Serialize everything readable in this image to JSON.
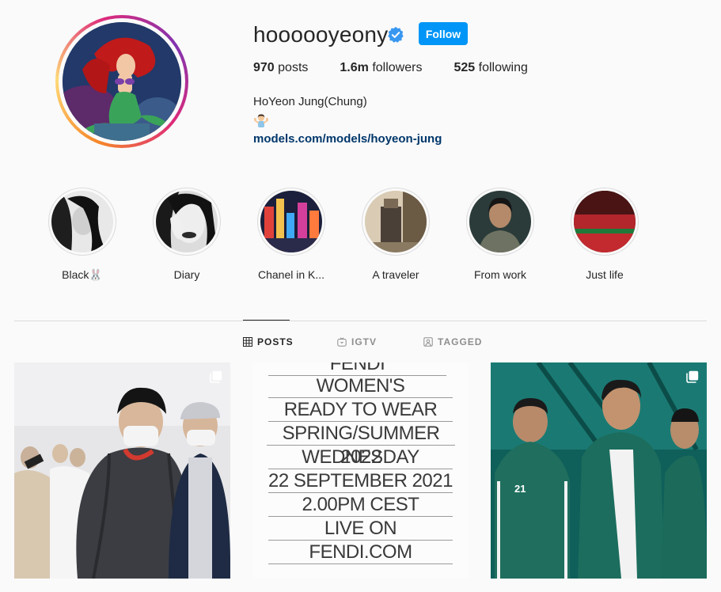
{
  "profile": {
    "username": "hoooooyeony",
    "follow_label": "Follow",
    "stats": {
      "posts_count": "970",
      "posts_label": "posts",
      "followers_count": "1.6m",
      "followers_label": "followers",
      "following_count": "525",
      "following_label": "following"
    },
    "full_name": "HoYeon Jung(Chung)",
    "bio_link": "models.com/models/hoyeon-jung",
    "colors": {
      "follow_button": "#0095f6",
      "link": "#00376b",
      "verified": "#3897f0"
    }
  },
  "highlights": [
    {
      "label": "Black🐰",
      "icon": "highlight-black"
    },
    {
      "label": "Diary",
      "icon": "highlight-diary"
    },
    {
      "label": "Chanel in K...",
      "icon": "highlight-chanel"
    },
    {
      "label": "A traveler",
      "icon": "highlight-traveler"
    },
    {
      "label": "From work",
      "icon": "highlight-from-work"
    },
    {
      "label": "Just life",
      "icon": "highlight-just-life"
    }
  ],
  "tabs": [
    {
      "label": "POSTS",
      "icon": "grid-icon",
      "active": true
    },
    {
      "label": "IGTV",
      "icon": "igtv-icon",
      "active": false
    },
    {
      "label": "TAGGED",
      "icon": "tagged-icon",
      "active": false
    }
  ],
  "posts": {
    "fendi_lines": [
      "FENDI",
      "WOMEN'S",
      "READY TO WEAR",
      "SPRING/SUMMER 2022",
      "WEDNESDAY",
      "22 SEPTEMBER 2021",
      "2.00PM CEST",
      "LIVE ON",
      "FENDI.COM"
    ],
    "squid_number": "21"
  }
}
